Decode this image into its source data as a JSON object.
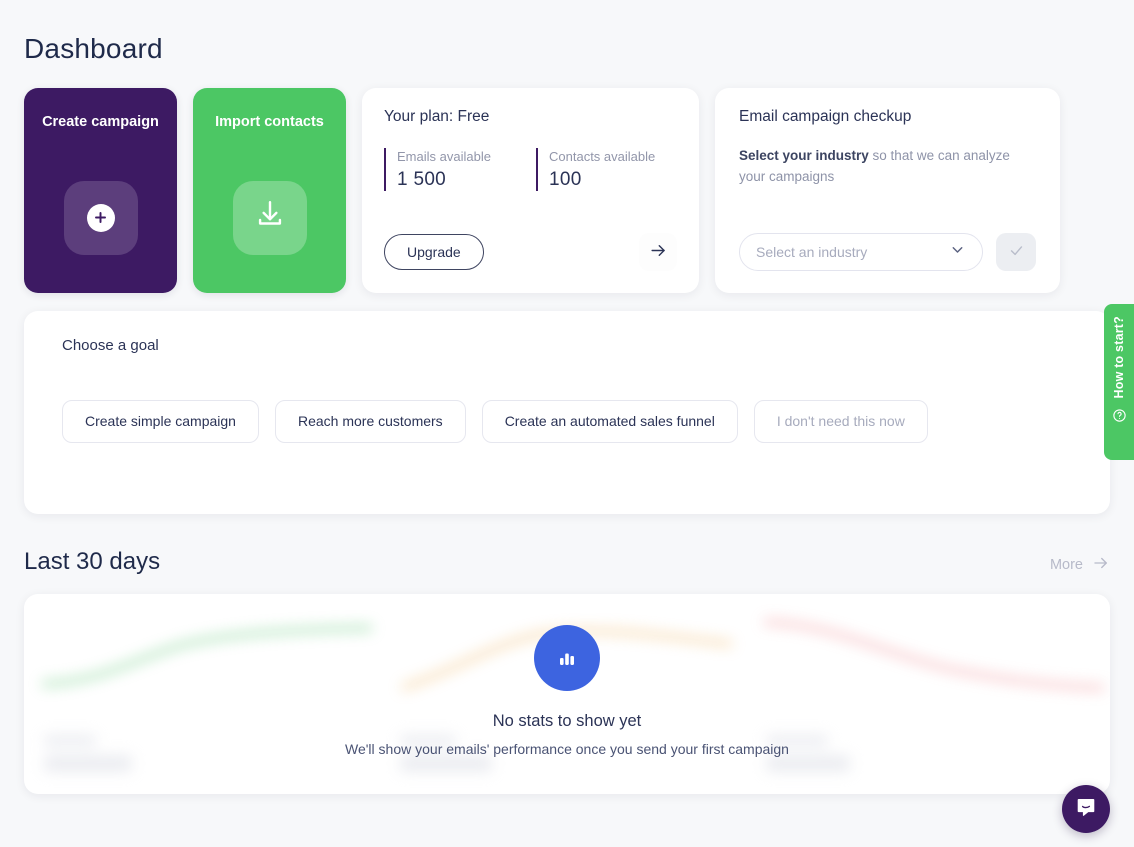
{
  "page": {
    "title": "Dashboard"
  },
  "quick_actions": [
    {
      "label": "Create campaign",
      "icon": "plus-icon",
      "color": "#3d1a63"
    },
    {
      "label": "Import contacts",
      "icon": "download-icon",
      "color": "#4cc764"
    }
  ],
  "plan_card": {
    "title": "Your plan: Free",
    "stats": [
      {
        "label": "Emails available",
        "value": "1 500"
      },
      {
        "label": "Contacts available",
        "value": "100"
      }
    ],
    "upgrade_label": "Upgrade",
    "arrow_icon": "arrow-right-icon",
    "accent": "#3d1a63"
  },
  "checkup_card": {
    "title": "Email campaign checkup",
    "desc_strong": "Select your industry",
    "desc_rest": " so that we can analyze your campaigns",
    "select_placeholder": "Select an industry",
    "chevron_icon": "chevron-down-icon",
    "confirm_icon": "check-icon"
  },
  "goal_section": {
    "title": "Choose a goal",
    "buttons": [
      {
        "label": "Create simple campaign",
        "muted": false
      },
      {
        "label": "Reach more customers",
        "muted": false
      },
      {
        "label": "Create an automated sales funnel",
        "muted": false
      },
      {
        "label": "I don't need this now",
        "muted": true
      }
    ]
  },
  "last_30_days": {
    "title": "Last 30 days",
    "more_label": "More",
    "more_icon": "arrow-right-icon",
    "empty_state": {
      "icon": "bar-chart-icon",
      "title": "No stats to show yet",
      "subtitle": "We'll show your emails' performance once you send your first campaign",
      "accent": "#3d64e0"
    }
  },
  "side_tab": {
    "label": "How to start?",
    "icon": "question-circle-icon",
    "color": "#4cc764"
  },
  "chat_widget": {
    "icon": "chat-bubble-icon",
    "color": "#3d1a63"
  },
  "colors": {
    "background": "#f7f8fa",
    "card": "#ffffff",
    "purple": "#3d1a63",
    "green": "#4cc764",
    "blue": "#3d64e0",
    "text_dark": "#2b3356",
    "text_muted": "#a7abbd"
  }
}
